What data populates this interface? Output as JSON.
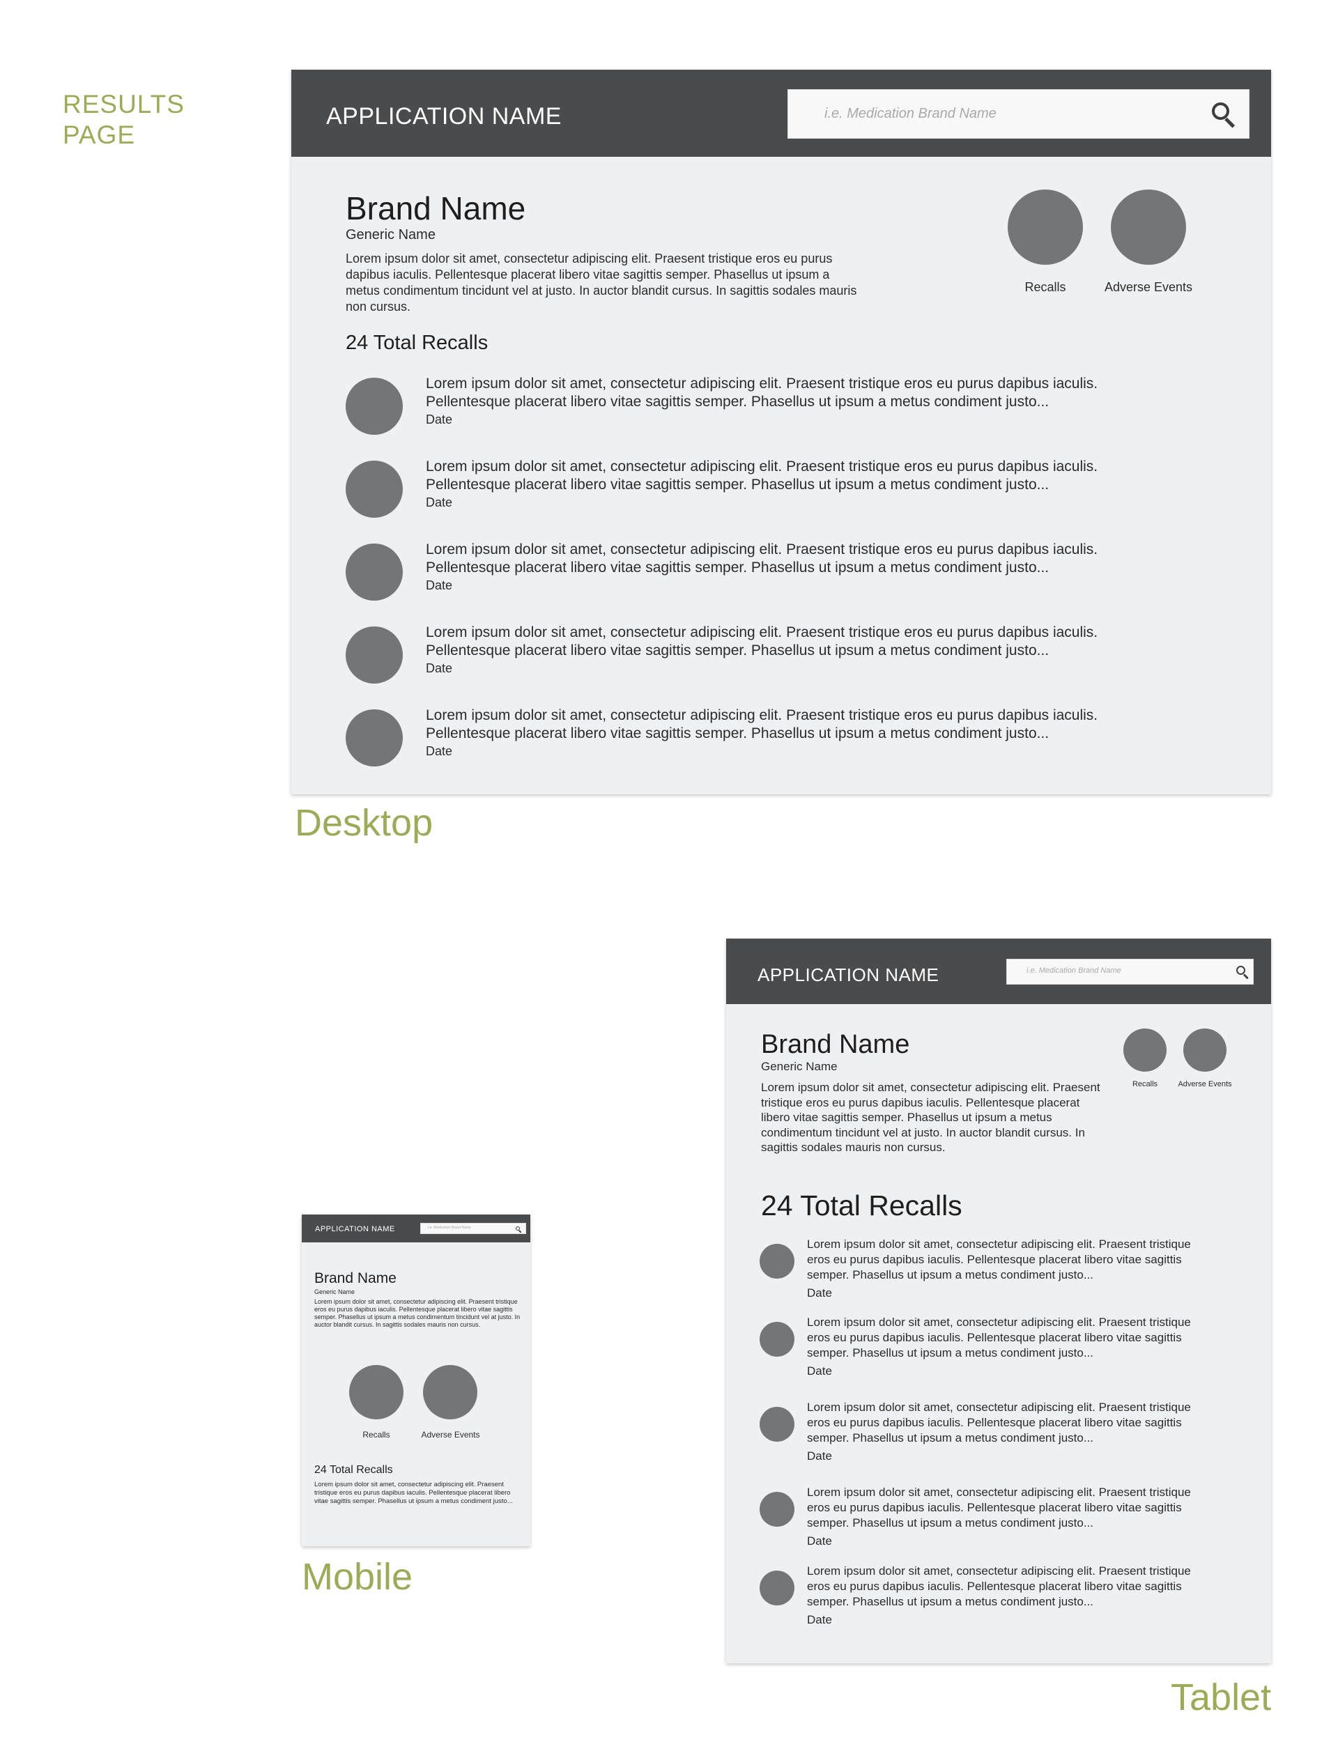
{
  "page_label": "RESULTS\nPAGE",
  "search": {
    "placeholder": "i.e. Medication Brand Name"
  },
  "app_name": "APPLICATION NAME",
  "product": {
    "brand": "Brand Name",
    "generic": "Generic Name",
    "description": "Lorem ipsum dolor sit amet, consectetur adipiscing elit. Praesent tristique eros eu purus dapibus iaculis. Pellentesque placerat libero vitae sagittis semper. Phasellus ut ipsum a metus condimentum tincidunt vel at justo. In auctor blandit cursus. In sagittis sodales mauris non cursus."
  },
  "stats": {
    "recalls_label": "Recalls",
    "adverse_label": "Adverse Events"
  },
  "recalls": {
    "total_label": "24 Total Recalls",
    "items": [
      {
        "text": "Lorem ipsum dolor sit amet, consectetur adipiscing elit. Praesent tristique eros eu purus dapibus iaculis. Pellentesque placerat libero vitae sagittis semper. Phasellus ut ipsum a metus condiment justo...",
        "date": "Date"
      },
      {
        "text": "Lorem ipsum dolor sit amet, consectetur adipiscing elit. Praesent tristique eros eu purus dapibus iaculis. Pellentesque placerat libero vitae sagittis semper. Phasellus ut ipsum a metus condiment justo...",
        "date": "Date"
      },
      {
        "text": "Lorem ipsum dolor sit amet, consectetur adipiscing elit. Praesent tristique eros eu purus dapibus iaculis. Pellentesque placerat libero vitae sagittis semper. Phasellus ut ipsum a metus condiment justo...",
        "date": "Date"
      },
      {
        "text": "Lorem ipsum dolor sit amet, consectetur adipiscing elit. Praesent tristique eros eu purus dapibus iaculis. Pellentesque placerat libero vitae sagittis semper. Phasellus ut ipsum a metus condiment justo...",
        "date": "Date"
      },
      {
        "text": "Lorem ipsum dolor sit amet, consectetur adipiscing elit. Praesent tristique eros eu purus dapibus iaculis. Pellentesque placerat libero vitae sagittis semper. Phasellus ut ipsum a metus condiment justo...",
        "date": "Date"
      }
    ]
  },
  "mobile_recall_preview": "Lorem ipsum dolor sit amet, consectetur adipiscing elit. Praesent tristique eros eu purus dapibus iaculis. Pellentesque placerat libero vitae sagittis semper. Phasellus ut ipsum a metus condiment justo...",
  "captions": {
    "desktop": "Desktop",
    "mobile": "Mobile",
    "tablet": "Tablet"
  },
  "colors": {
    "accent_green": "#9bab5a",
    "header_bg": "#4a4b4d",
    "panel_bg": "#eff0f2",
    "placeholder_circle": "#747577"
  }
}
